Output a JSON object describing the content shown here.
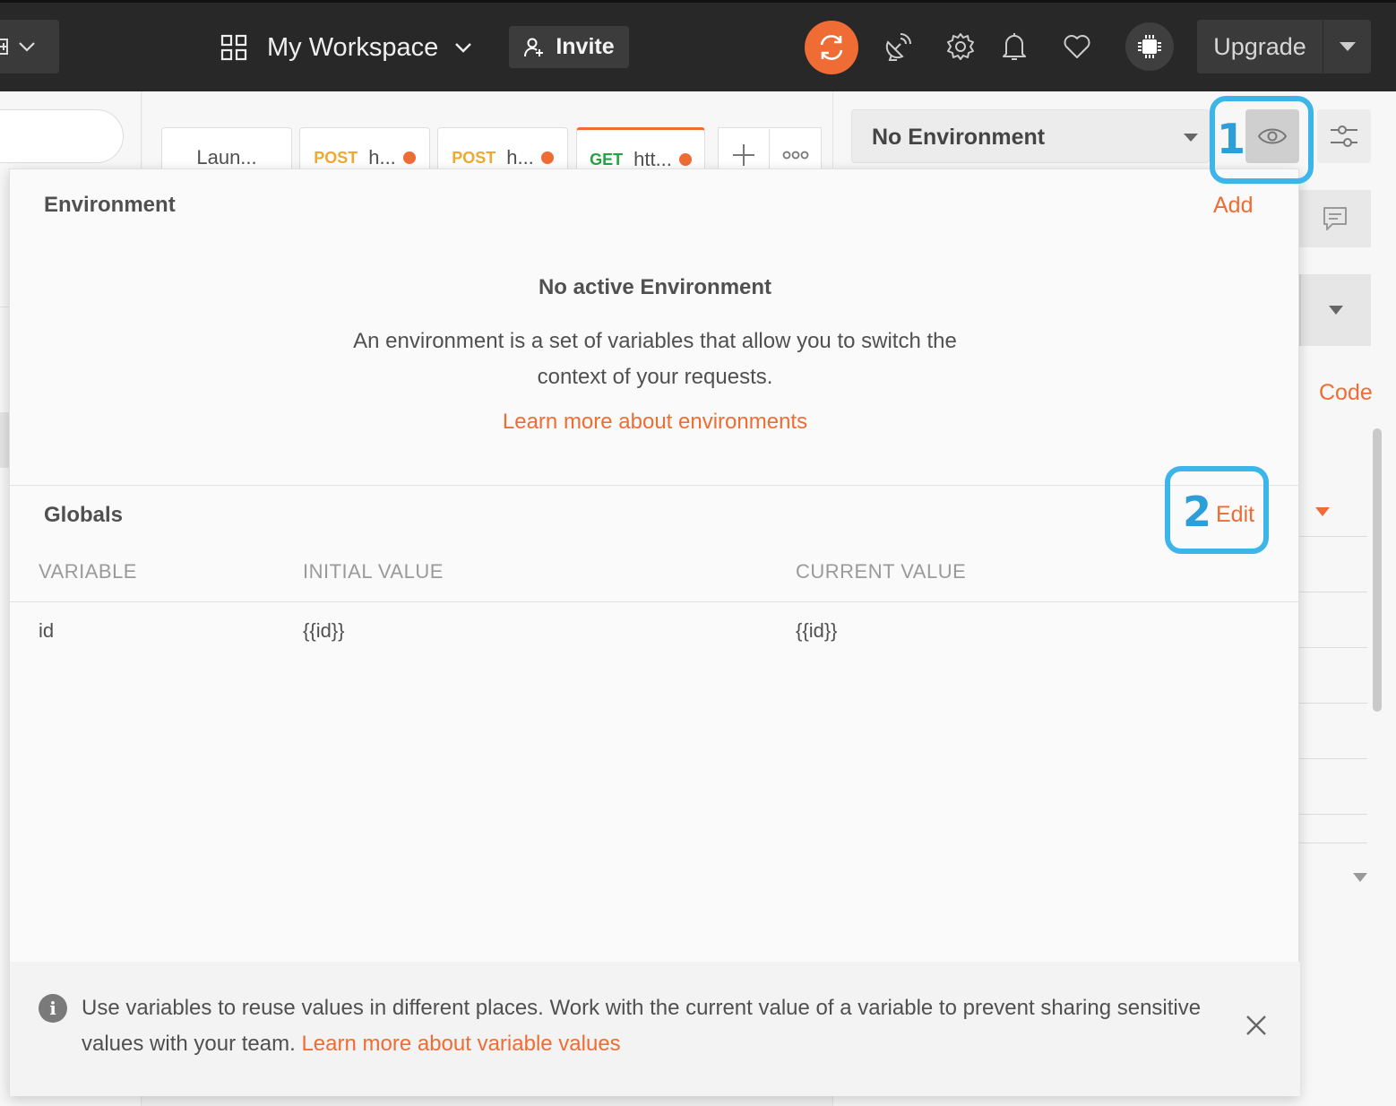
{
  "header": {
    "workspace_label": "My Workspace",
    "invite_label": "Invite",
    "upgrade_label": "Upgrade"
  },
  "tabs": [
    {
      "method": "",
      "label": "Laun...",
      "unsaved": false,
      "active": false
    },
    {
      "method": "POST",
      "label": "h...",
      "unsaved": true,
      "active": false,
      "method_color": "#f0a930"
    },
    {
      "method": "POST",
      "label": "h...",
      "unsaved": true,
      "active": false,
      "method_color": "#f0a930"
    },
    {
      "method": "GET",
      "label": "htt...",
      "unsaved": true,
      "active": true,
      "method_color": "#26a342"
    }
  ],
  "environment_selector": {
    "selected": "No Environment"
  },
  "right_panel": {
    "code_link": "Code"
  },
  "annotations": {
    "callout_1": "1",
    "callout_2": "2",
    "callout_color": "#3cb5e8"
  },
  "popover": {
    "environment": {
      "title": "Environment",
      "add_label": "Add",
      "empty_title": "No active Environment",
      "empty_description": "An environment is a set of variables that allow you to switch the context of your requests.",
      "learn_more": "Learn more about environments"
    },
    "globals": {
      "title": "Globals",
      "edit_label": "Edit",
      "columns": [
        "VARIABLE",
        "INITIAL VALUE",
        "CURRENT VALUE"
      ],
      "rows": [
        {
          "variable": "id",
          "initial_value": "{{id}}",
          "current_value": "{{id}}"
        }
      ]
    },
    "info": {
      "text": "Use variables to reuse values in different places. Work with the current value of a variable to prevent sharing sensitive values with your team.",
      "link": "Learn more about variable values",
      "icon": "info-icon"
    }
  },
  "colors": {
    "accent": "#ef6c35",
    "topbar": "#282828"
  }
}
